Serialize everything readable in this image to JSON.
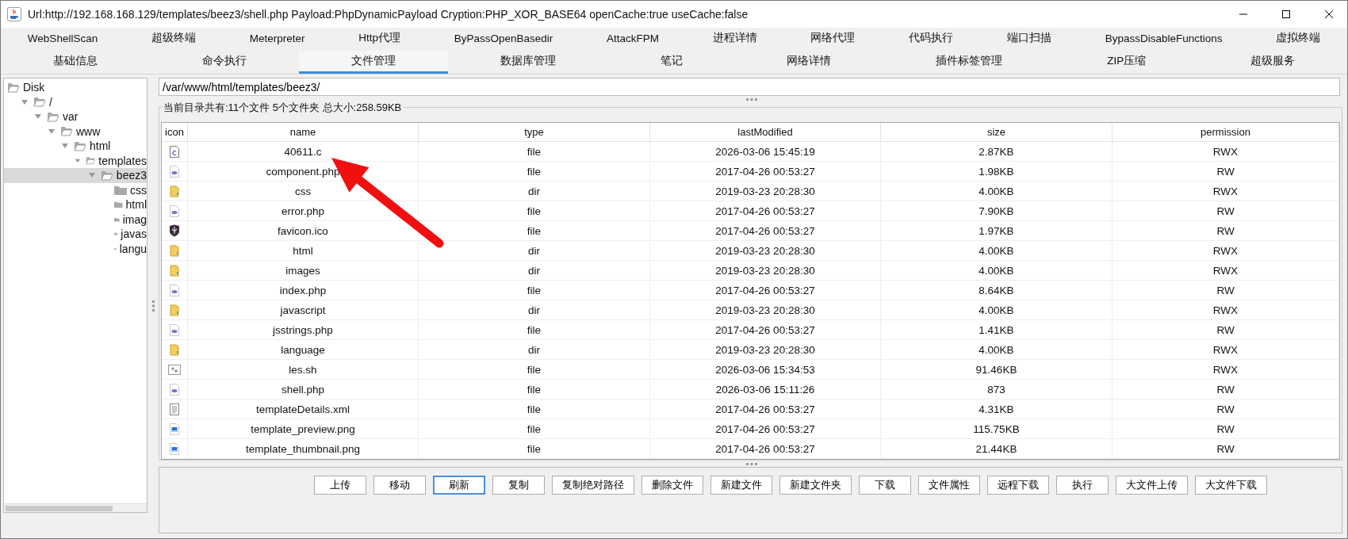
{
  "window": {
    "title": "Url:http://192.168.168.129/templates/beez3/shell.php Payload:PhpDynamicPayload Cryption:PHP_XOR_BASE64 openCache:true useCache:false"
  },
  "tab_rows": [
    [
      {
        "label": "WebShellScan",
        "selected": false
      },
      {
        "label": "超级终端",
        "selected": false
      },
      {
        "label": "Meterpreter",
        "selected": false
      },
      {
        "label": "Http代理",
        "selected": false
      },
      {
        "label": "ByPassOpenBasedir",
        "selected": false
      },
      {
        "label": "AttackFPM",
        "selected": false
      },
      {
        "label": "进程详情",
        "selected": false
      },
      {
        "label": "网络代理",
        "selected": false
      },
      {
        "label": "代码执行",
        "selected": false
      },
      {
        "label": "端口扫描",
        "selected": false
      },
      {
        "label": "BypassDisableFunctions",
        "selected": false
      },
      {
        "label": "虚拟终端",
        "selected": false
      }
    ],
    [
      {
        "label": "基础信息",
        "selected": false
      },
      {
        "label": "命令执行",
        "selected": false
      },
      {
        "label": "文件管理",
        "selected": true
      },
      {
        "label": "数据库管理",
        "selected": false
      },
      {
        "label": "笔记",
        "selected": false
      },
      {
        "label": "网络详情",
        "selected": false
      },
      {
        "label": "插件标签管理",
        "selected": false
      },
      {
        "label": "ZIP压缩",
        "selected": false
      },
      {
        "label": "超级服务",
        "selected": false
      }
    ]
  ],
  "tree": {
    "label": "Disk",
    "children": [
      {
        "label": "/",
        "expanded": true,
        "selected": false,
        "children": [
          {
            "label": "var",
            "expanded": true,
            "selected": false,
            "children": [
              {
                "label": "www",
                "expanded": true,
                "selected": false,
                "children": [
                  {
                    "label": "html",
                    "expanded": true,
                    "selected": false,
                    "children": [
                      {
                        "label": "templates",
                        "expanded": true,
                        "selected": false,
                        "children": [
                          {
                            "label": "beez3",
                            "expanded": true,
                            "selected": true,
                            "children": [
                              {
                                "label": "css",
                                "selected": false
                              },
                              {
                                "label": "html",
                                "selected": false
                              },
                              {
                                "label": "imag",
                                "selected": false
                              },
                              {
                                "label": "javas",
                                "selected": false
                              },
                              {
                                "label": "langu",
                                "selected": false
                              }
                            ]
                          }
                        ]
                      }
                    ]
                  }
                ]
              }
            ]
          }
        ]
      }
    ]
  },
  "path_field": {
    "value": "/var/www/html/templates/beez3/"
  },
  "summary": "当前目录共有:11个文件 5个文件夹 总大小:258.59KB",
  "table": {
    "columns": [
      "icon",
      "name",
      "type",
      "lastModified",
      "size",
      "permission"
    ],
    "rows": [
      {
        "kind": "c",
        "name": "40611.c",
        "type": "file",
        "lastModified": "2026-03-06 15:45:19",
        "size": "2.87KB",
        "permission": "RWX"
      },
      {
        "kind": "php",
        "name": "component.php",
        "type": "file",
        "lastModified": "2017-04-26 00:53:27",
        "size": "1.98KB",
        "permission": "RW"
      },
      {
        "kind": "dir",
        "name": "css",
        "type": "dir",
        "lastModified": "2019-03-23 20:28:30",
        "size": "4.00KB",
        "permission": "RWX"
      },
      {
        "kind": "php",
        "name": "error.php",
        "type": "file",
        "lastModified": "2017-04-26 00:53:27",
        "size": "7.90KB",
        "permission": "RW"
      },
      {
        "kind": "ico",
        "name": "favicon.ico",
        "type": "file",
        "lastModified": "2017-04-26 00:53:27",
        "size": "1.97KB",
        "permission": "RW"
      },
      {
        "kind": "dir",
        "name": "html",
        "type": "dir",
        "lastModified": "2019-03-23 20:28:30",
        "size": "4.00KB",
        "permission": "RWX"
      },
      {
        "kind": "dir",
        "name": "images",
        "type": "dir",
        "lastModified": "2019-03-23 20:28:30",
        "size": "4.00KB",
        "permission": "RWX"
      },
      {
        "kind": "php",
        "name": "index.php",
        "type": "file",
        "lastModified": "2017-04-26 00:53:27",
        "size": "8.64KB",
        "permission": "RW"
      },
      {
        "kind": "dir",
        "name": "javascript",
        "type": "dir",
        "lastModified": "2019-03-23 20:28:30",
        "size": "4.00KB",
        "permission": "RWX"
      },
      {
        "kind": "php",
        "name": "jsstrings.php",
        "type": "file",
        "lastModified": "2017-04-26 00:53:27",
        "size": "1.41KB",
        "permission": "RW"
      },
      {
        "kind": "dir",
        "name": "language",
        "type": "dir",
        "lastModified": "2019-03-23 20:28:30",
        "size": "4.00KB",
        "permission": "RWX"
      },
      {
        "kind": "sh",
        "name": "les.sh",
        "type": "file",
        "lastModified": "2026-03-06 15:34:53",
        "size": "91.46KB",
        "permission": "RWX"
      },
      {
        "kind": "php",
        "name": "shell.php",
        "type": "file",
        "lastModified": "2026-03-06 15:11:26",
        "size": "873",
        "permission": "RW"
      },
      {
        "kind": "xml",
        "name": "templateDetails.xml",
        "type": "file",
        "lastModified": "2017-04-26 00:53:27",
        "size": "4.31KB",
        "permission": "RW"
      },
      {
        "kind": "png",
        "name": "template_preview.png",
        "type": "file",
        "lastModified": "2017-04-26 00:53:27",
        "size": "115.75KB",
        "permission": "RW"
      },
      {
        "kind": "png",
        "name": "template_thumbnail.png",
        "type": "file",
        "lastModified": "2017-04-26 00:53:27",
        "size": "21.44KB",
        "permission": "RW"
      }
    ]
  },
  "buttons": [
    {
      "label": "上传",
      "focused": false
    },
    {
      "label": "移动",
      "focused": false
    },
    {
      "label": "刷新",
      "focused": true
    },
    {
      "label": "复制",
      "focused": false
    },
    {
      "label": "复制绝对路径",
      "focused": false
    },
    {
      "label": "删除文件",
      "focused": false
    },
    {
      "label": "新建文件",
      "focused": false
    },
    {
      "label": "新建文件夹",
      "focused": false
    },
    {
      "label": "下载",
      "focused": false
    },
    {
      "label": "文件属性",
      "focused": false
    },
    {
      "label": "远程下载",
      "focused": false
    },
    {
      "label": "执行",
      "focused": false
    },
    {
      "label": "大文件上传",
      "focused": false
    },
    {
      "label": "大文件下载",
      "focused": false
    }
  ]
}
